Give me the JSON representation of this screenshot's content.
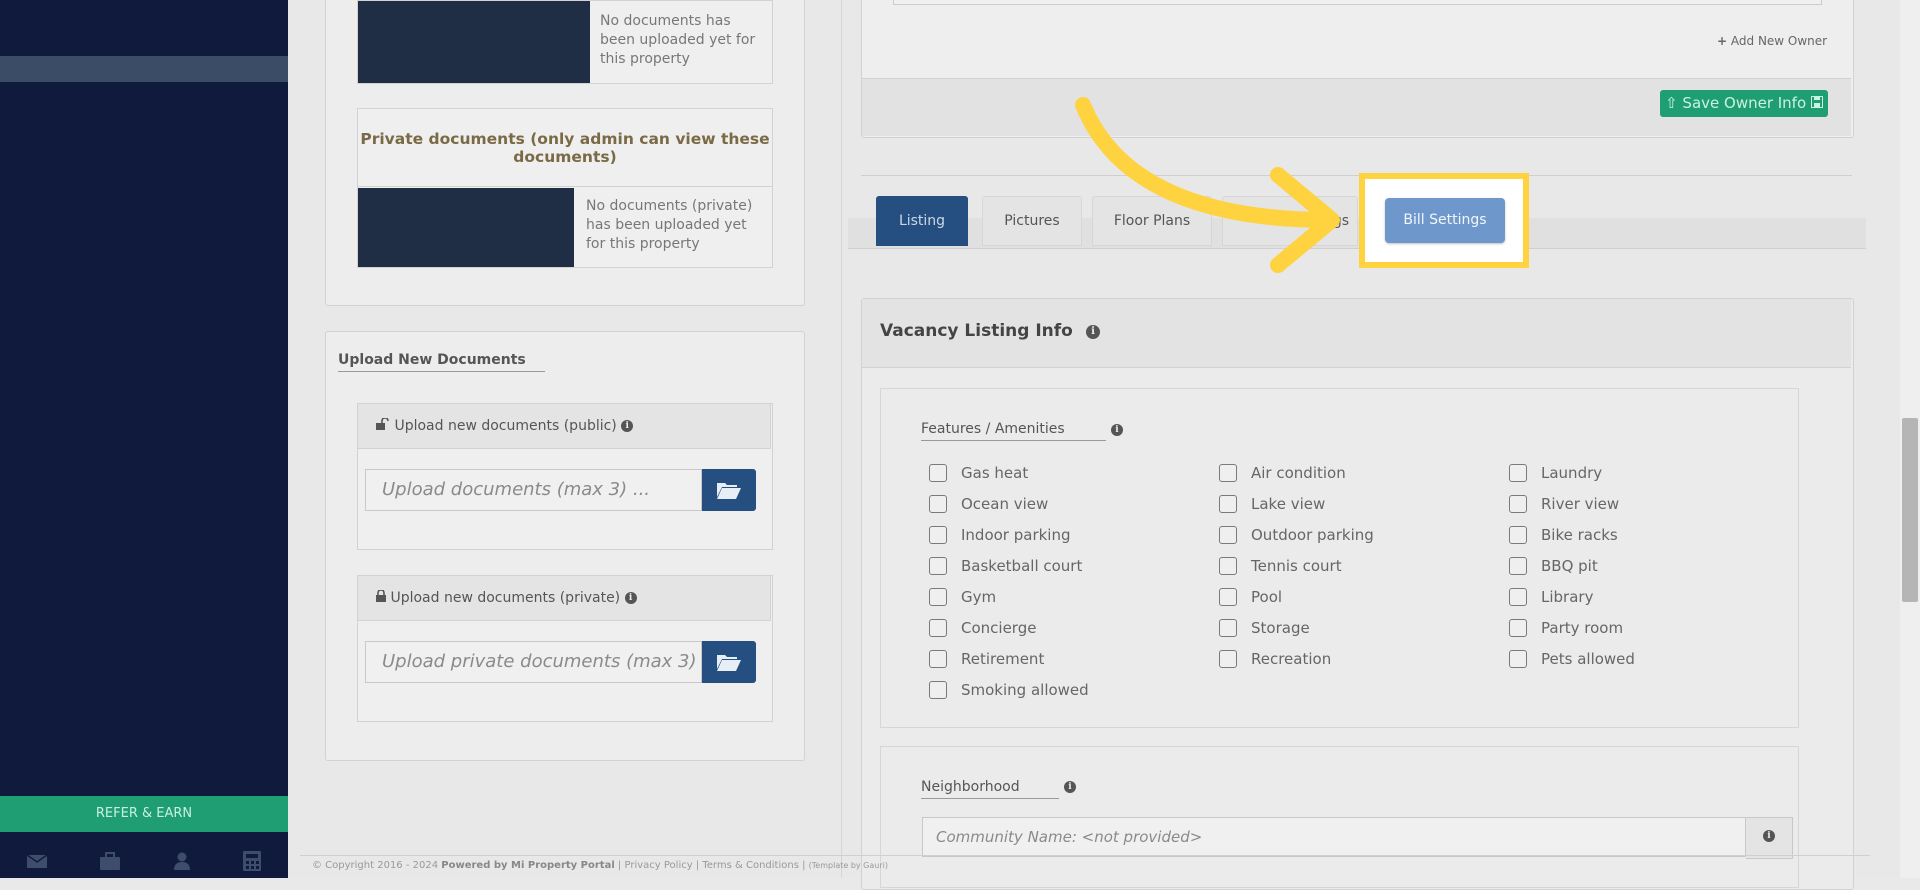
{
  "sidebar": {
    "refer_label": "REFER & EARN",
    "bottom_icons": [
      "envelope-icon",
      "briefcase-icon",
      "user-icon",
      "calculator-icon"
    ]
  },
  "documents": {
    "public_empty": "No documents has been uploaded yet for this property",
    "private_title": "Private documents (only admin can view these documents)",
    "private_empty": "No documents (private) has been uploaded yet for this property"
  },
  "upload": {
    "section_title": "Upload New Documents",
    "public_header": "Upload new documents (public)",
    "public_placeholder": "Upload documents (max 3) ...",
    "private_header": "Upload new documents (private)",
    "private_placeholder": "Upload private documents (max 3) ..."
  },
  "owner": {
    "add_new_owner": "Add New Owner",
    "save_owner_info": "Save Owner Info"
  },
  "tabs": [
    {
      "label": "Listing",
      "active": true
    },
    {
      "label": "Pictures"
    },
    {
      "label": "Floor Plans"
    },
    {
      "label": "ttings"
    },
    {
      "label": "Bill Settings",
      "highlighted": true
    }
  ],
  "vacancy": {
    "title": "Vacancy Listing Info",
    "features_title": "Features / Amenities",
    "amenities": [
      [
        "Gas heat",
        "Air condition",
        "Laundry"
      ],
      [
        "Ocean view",
        "Lake view",
        "River view"
      ],
      [
        "Indoor parking",
        "Outdoor parking",
        "Bike racks"
      ],
      [
        "Basketball court",
        "Tennis court",
        "BBQ pit"
      ],
      [
        "Gym",
        "Pool",
        "Library"
      ],
      [
        "Concierge",
        "Storage",
        "Party room"
      ],
      [
        "Retirement",
        "Recreation",
        "Pets allowed"
      ],
      [
        "Smoking allowed"
      ]
    ],
    "neighborhood_title": "Neighborhood",
    "community_placeholder": "Community Name: <not provided>"
  },
  "footer": {
    "copyright": "© Copyright 2016 - 2024",
    "powered": "Powered by Mi Property Portal",
    "privacy": "Privacy Policy",
    "terms": "Terms & Conditions",
    "template": "(Template by Gauri)"
  },
  "colors": {
    "sidebar_bg": "#0f1a3c",
    "refer_green": "#1f9e73",
    "primary_blue": "#254f80",
    "highlight_yellow": "#ffd23f",
    "save_green": "#1f9e73"
  }
}
